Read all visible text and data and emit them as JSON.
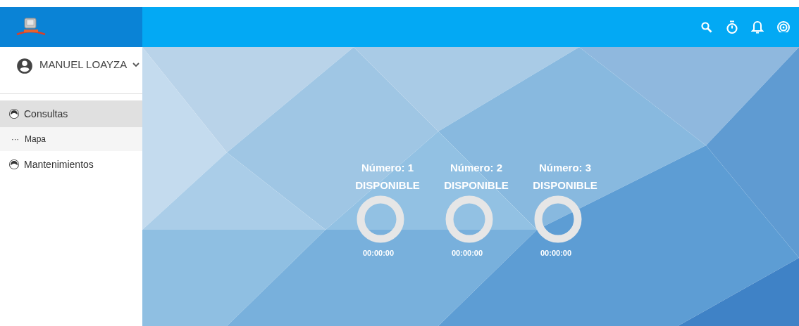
{
  "user": {
    "name": "MANUEL LOAYZA"
  },
  "menu": [
    {
      "label": "Consultas",
      "selected": true,
      "children": [
        {
          "label": "Mapa",
          "marker": "···"
        }
      ]
    },
    {
      "label": "Mantenimientos",
      "selected": false
    }
  ],
  "stations": [
    {
      "title": "Número: 1",
      "status": "DISPONIBLE",
      "time": "00:00:00"
    },
    {
      "title": "Número: 2",
      "status": "DISPONIBLE",
      "time": "00:00:00"
    },
    {
      "title": "Número: 3",
      "status": "DISPONIBLE",
      "time": "00:00:00"
    }
  ]
}
